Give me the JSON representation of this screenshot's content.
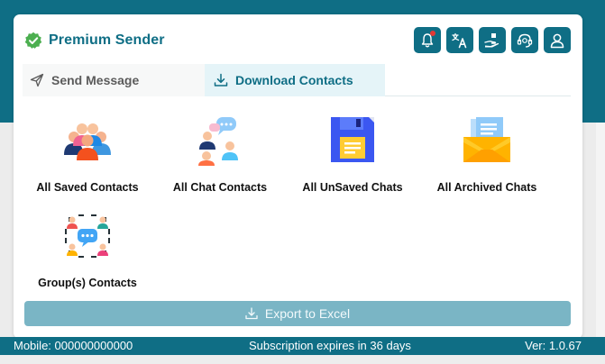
{
  "app": {
    "title": "Premium Sender"
  },
  "tabs": [
    {
      "label": "Send Message",
      "active": false
    },
    {
      "label": "Download Contacts",
      "active": true
    }
  ],
  "contacts": [
    {
      "label": "All Saved Contacts",
      "icon": "saved-contacts-icon"
    },
    {
      "label": "All Chat Contacts",
      "icon": "chat-contacts-icon"
    },
    {
      "label": "All UnSaved Chats",
      "icon": "unsaved-chats-icon"
    },
    {
      "label": "All Archived Chats",
      "icon": "archived-chats-icon"
    },
    {
      "label": "Group(s) Contacts",
      "icon": "group-contacts-icon"
    }
  ],
  "export": {
    "label": "Export to Excel"
  },
  "status": {
    "mobile": "Mobile: 000000000000",
    "subscription": "Subscription expires in 36 days",
    "version": "Ver: 1.0.67"
  },
  "colors": {
    "brand": "#0f6e85",
    "active_tab_bg": "#e5f4f8",
    "export_disabled": "#7ab5c5",
    "verified_green": "#4caf50",
    "notification_dot": "#e53935"
  },
  "header_icons": [
    "notification-bell-icon",
    "translate-icon",
    "donate-hand-icon",
    "support-headset-icon",
    "user-profile-icon"
  ]
}
